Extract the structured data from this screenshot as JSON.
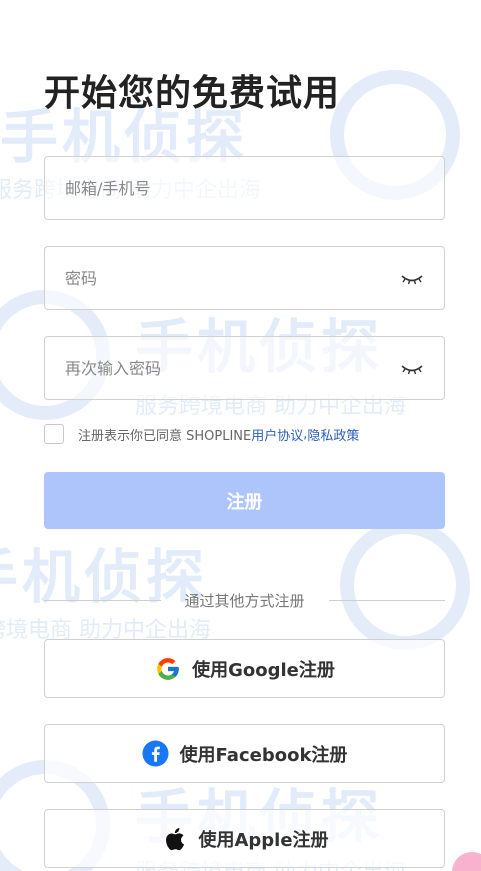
{
  "header": {
    "title": "开始您的免费试用"
  },
  "form": {
    "email_placeholder": "邮箱/手机号",
    "password_placeholder": "密码",
    "confirm_placeholder": "再次输入密码"
  },
  "agreement": {
    "prefix": "注册表示你已同意 SHOPLINE ",
    "terms_link": "用户协议",
    "separator": ", ",
    "privacy_link": "隐私政策"
  },
  "register_button": "注册",
  "divider_text": "通过其他方式注册",
  "social": {
    "google": {
      "label": "使用Google注册",
      "icon": "google-icon"
    },
    "facebook": {
      "label": "使用Facebook注册",
      "icon": "facebook-icon"
    },
    "apple": {
      "label": "使用Apple注册",
      "icon": "apple-icon"
    }
  },
  "watermark": {
    "brand": "手机侦探",
    "slogan": "服务跨境电商 助力中企出海"
  },
  "colors": {
    "primary_disabled": "#aec5fb",
    "link": "#2a5fb8",
    "facebook": "#1877f2"
  }
}
